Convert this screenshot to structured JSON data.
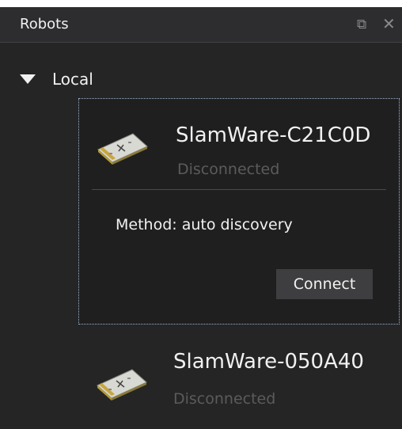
{
  "panel": {
    "title": "Robots",
    "float_icon": "float-window-icon",
    "close_icon": "close-icon",
    "float_glyph": "⧉",
    "close_glyph": "✕"
  },
  "group": {
    "label": "Local",
    "expanded": true
  },
  "robots": [
    {
      "name": "SlamWare-C21C0D",
      "status": "Disconnected",
      "method": "Method: auto discovery",
      "connect_label": "Connect",
      "selected": true,
      "icon": "robot-module-icon"
    },
    {
      "name": "SlamWare-050A40",
      "status": "Disconnected",
      "selected": false,
      "icon": "robot-module-icon"
    }
  ],
  "colors": {
    "panel_bg": "#252526",
    "titlebar_bg": "#2d2d30",
    "text": "#f1f1f1",
    "muted_text": "#5b5b5b",
    "button_bg": "#3e3e40",
    "selection_border": "#9fb7cf"
  }
}
